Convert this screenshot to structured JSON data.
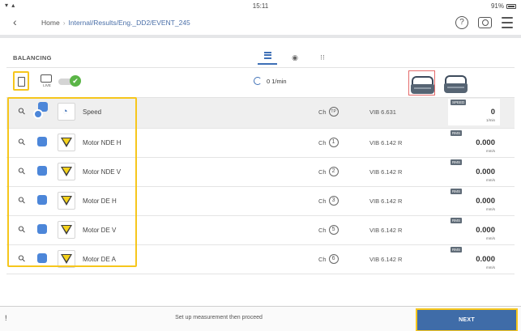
{
  "status_bar": {
    "time": "15:11",
    "left": "▾ ▴",
    "battery": "91%"
  },
  "nav": {
    "back": "‹",
    "home": "Home",
    "separator": "›",
    "path": "Internal/Results/Eng._DD2/EVENT_245",
    "help_glyph": "?"
  },
  "panel": {
    "title": "BALANCING",
    "view_tabs": [
      "list",
      "eye-icon",
      "grid-icon"
    ]
  },
  "toolbar": {
    "live_label": "LIVE",
    "check": "✔",
    "speed_readout": "0 1/min"
  },
  "rows": [
    {
      "name": "Speed",
      "ch": "Ch",
      "ch_num": "TP",
      "vib": "VIB 6.631",
      "badge": "SPEED",
      "value": "0",
      "unit": "1/min"
    },
    {
      "name": "Motor NDE H",
      "ch": "Ch",
      "ch_num": "1",
      "vib": "VIB 6.142 R",
      "badge": "RMS",
      "value": "0.000",
      "unit": "mm/s"
    },
    {
      "name": "Motor NDE V",
      "ch": "Ch",
      "ch_num": "2",
      "vib": "VIB 6.142 R",
      "badge": "RMS",
      "value": "0.000",
      "unit": "mm/s"
    },
    {
      "name": "Motor DE H",
      "ch": "Ch",
      "ch_num": "3",
      "vib": "VIB 6.142 R",
      "badge": "RMS",
      "value": "0.000",
      "unit": "mm/s"
    },
    {
      "name": "Motor DE V",
      "ch": "Ch",
      "ch_num": "5",
      "vib": "VIB 6.142 R",
      "badge": "RMS",
      "value": "0.000",
      "unit": "mm/s"
    },
    {
      "name": "Motor DE A",
      "ch": "Ch",
      "ch_num": "6",
      "vib": "VIB 6.142 R",
      "badge": "RMS",
      "value": "0.000",
      "unit": "mm/s"
    }
  ],
  "footer": {
    "mark": "!",
    "message": "Set up measurement then proceed",
    "next_label": "NEXT"
  },
  "colors": {
    "accent": "#3f6ca8",
    "highlight": "#f6c61c",
    "selected_machine": "#e56b6b",
    "ok": "#5bb547"
  }
}
